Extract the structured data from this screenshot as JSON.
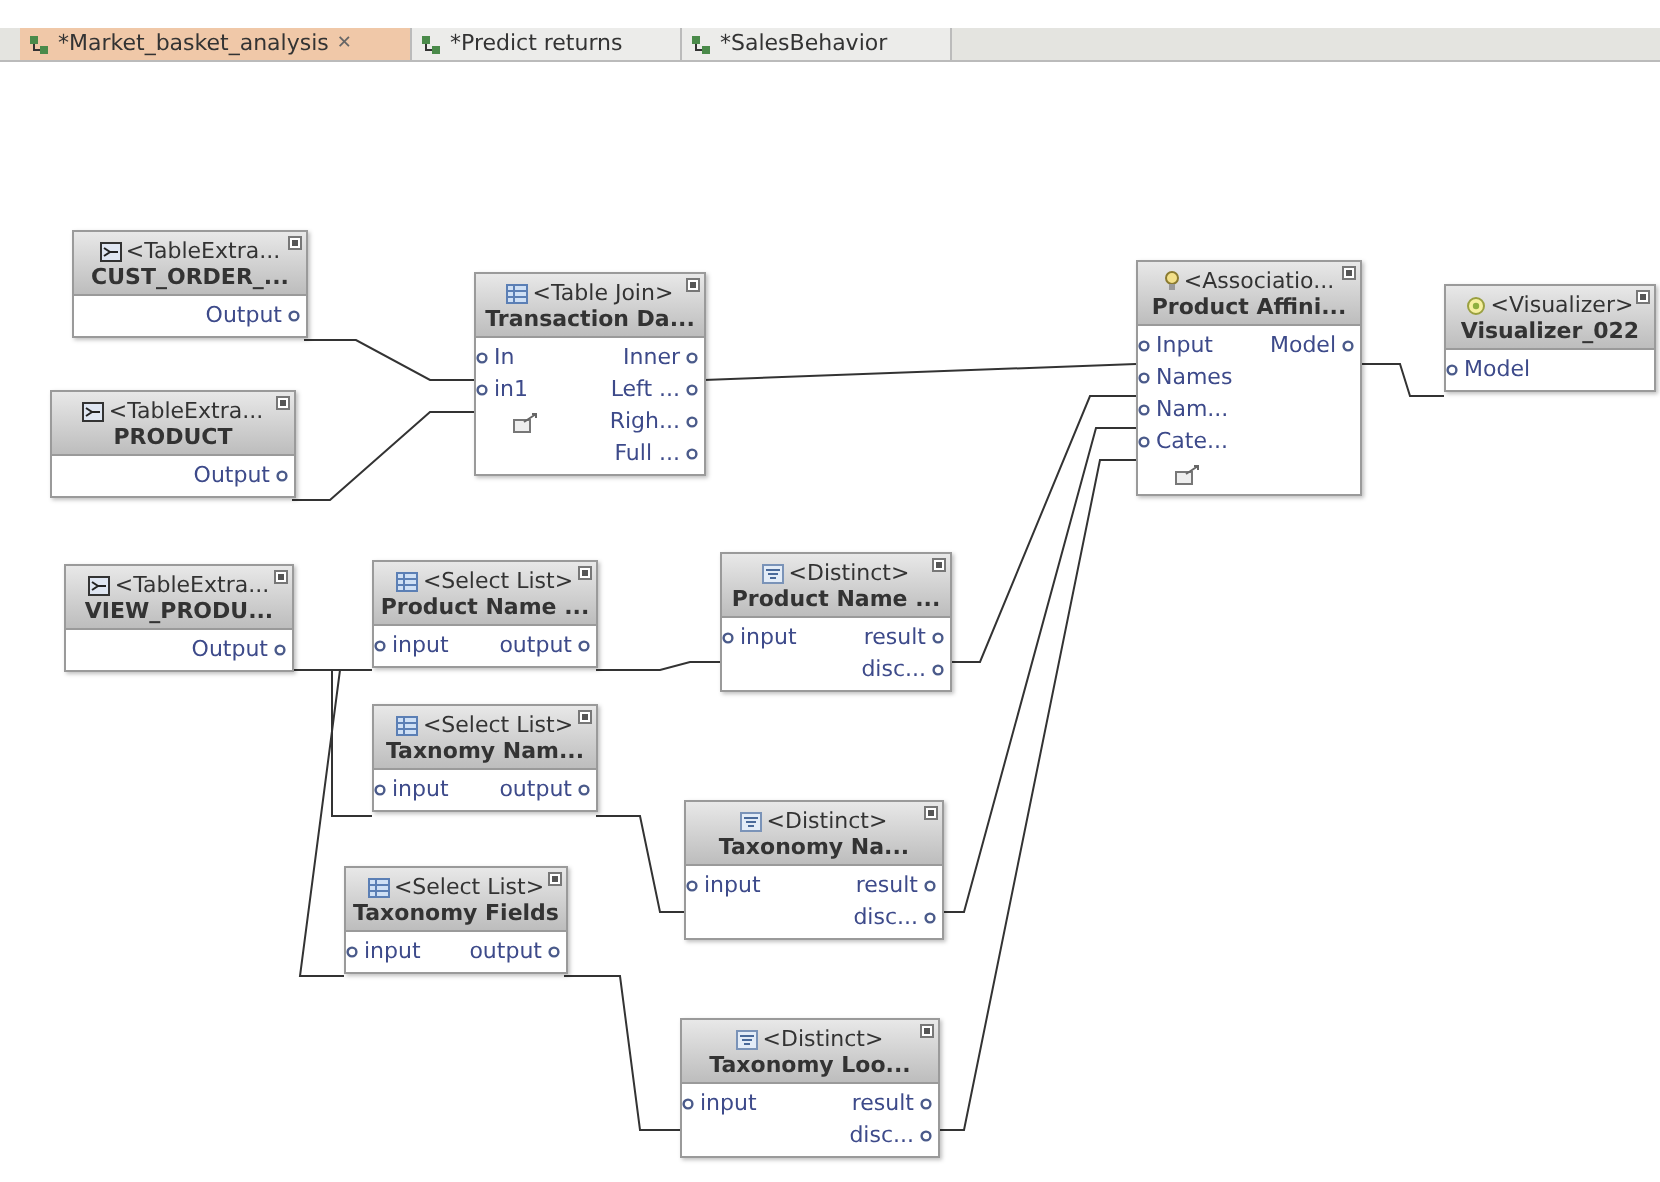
{
  "tabs": [
    {
      "label": "*Market_basket_analysis",
      "selected": true,
      "close": "✕"
    },
    {
      "label": "*Predict returns",
      "selected": false
    },
    {
      "label": "*SalesBehavior",
      "selected": false
    }
  ],
  "nodes": [
    {
      "kind": "extract",
      "type": "<TableExtra...",
      "name": "CUST_ORDER_...",
      "outputs": [
        "Output"
      ]
    },
    {
      "kind": "extract",
      "type": "<TableExtra...",
      "name": "PRODUCT",
      "outputs": [
        "Output"
      ]
    },
    {
      "kind": "join",
      "type": "<Table Join>",
      "name": "Transaction Da...",
      "inputs": [
        "In",
        "in1"
      ],
      "outputs": [
        "Inner",
        "Left ...",
        "Righ...",
        "Full ..."
      ]
    },
    {
      "kind": "association",
      "type": "<Associatio...",
      "name": "Product Affini...",
      "inputs": [
        "Input",
        "Names",
        "Nam...",
        "Cate..."
      ],
      "outputs": [
        "Model"
      ]
    },
    {
      "kind": "visualizer",
      "type": "<Visualizer>",
      "name": "Visualizer_022",
      "inputs": [
        "Model"
      ]
    },
    {
      "kind": "extract",
      "type": "<TableExtra...",
      "name": "VIEW_PRODU...",
      "outputs": [
        "Output"
      ]
    },
    {
      "kind": "select",
      "type": "<Select List>",
      "name": "Product Name ...",
      "inputs": [
        "input"
      ],
      "outputs": [
        "output"
      ]
    },
    {
      "kind": "distinct",
      "type": "<Distinct>",
      "name": "Product Name ...",
      "inputs": [
        "input"
      ],
      "outputs": [
        "result",
        "disc..."
      ]
    },
    {
      "kind": "select",
      "type": "<Select List>",
      "name": "Taxnomy Nam...",
      "inputs": [
        "input"
      ],
      "outputs": [
        "output"
      ]
    },
    {
      "kind": "distinct",
      "type": "<Distinct>",
      "name": "Taxonomy Na...",
      "inputs": [
        "input"
      ],
      "outputs": [
        "result",
        "disc..."
      ]
    },
    {
      "kind": "select",
      "type": "<Select List>",
      "name": "Taxonomy Fields",
      "inputs": [
        "input"
      ],
      "outputs": [
        "output"
      ]
    },
    {
      "kind": "distinct",
      "type": "<Distinct>",
      "name": "Taxonomy Loo...",
      "inputs": [
        "input"
      ],
      "outputs": [
        "result",
        "disc..."
      ]
    }
  ]
}
